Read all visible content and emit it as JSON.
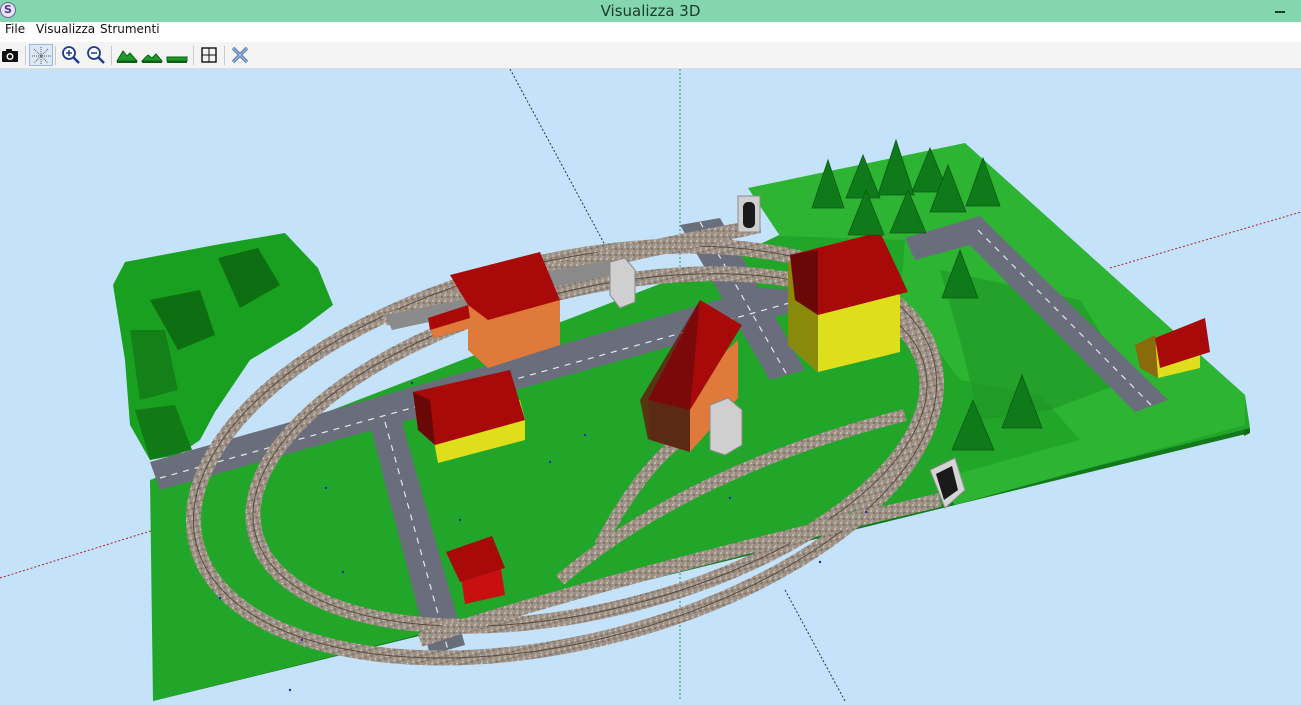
{
  "window": {
    "title": "Visualizza 3D",
    "app_icon_letter": "S"
  },
  "menu": [
    {
      "label": "File"
    },
    {
      "label": "Visualizza"
    },
    {
      "label": "Strumenti"
    }
  ],
  "toolbar": {
    "buttons": [
      {
        "icon": "camera-icon",
        "tooltip": ""
      },
      {
        "icon": "axes-icon",
        "active": true
      },
      {
        "icon": "zoom-in-icon"
      },
      {
        "icon": "zoom-out-icon"
      },
      {
        "icon": "terrain-high-icon"
      },
      {
        "icon": "terrain-low-icon"
      },
      {
        "icon": "terrain-flat-icon"
      },
      {
        "icon": "fit-view-icon"
      },
      {
        "icon": "close-view-icon"
      }
    ]
  },
  "scene": {
    "background_color": "#c5e2fb",
    "baseboard_color": "#22a62a",
    "road_color": "#6a6e7c",
    "roof_color": "#a80a0a",
    "wall_colors": [
      "#e07a3a",
      "#dede1a",
      "#7a3a20"
    ],
    "content": "3D model railway layout"
  }
}
